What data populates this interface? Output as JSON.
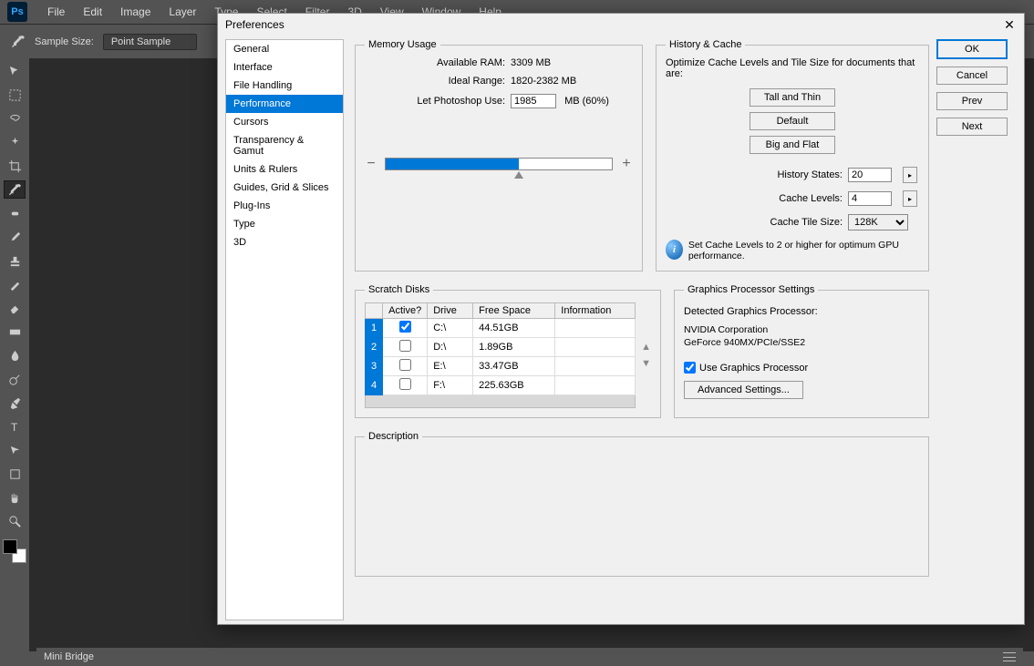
{
  "app": {
    "logo": "Ps"
  },
  "menu": [
    "File",
    "Edit",
    "Image",
    "Layer",
    "Type",
    "Select",
    "Filter",
    "3D",
    "View",
    "Window",
    "Help"
  ],
  "options": {
    "sample_label": "Sample Size:",
    "sample_value": "Point Sample"
  },
  "bottom_panel": "Mini Bridge",
  "dialog": {
    "title": "Preferences",
    "sidebar": [
      "General",
      "Interface",
      "File Handling",
      "Performance",
      "Cursors",
      "Transparency & Gamut",
      "Units & Rulers",
      "Guides, Grid & Slices",
      "Plug-Ins",
      "Type",
      "3D"
    ],
    "selected_index": 3,
    "buttons": {
      "ok": "OK",
      "cancel": "Cancel",
      "prev": "Prev",
      "next": "Next"
    },
    "memory": {
      "legend": "Memory Usage",
      "available_lbl": "Available RAM:",
      "available_val": "3309 MB",
      "ideal_lbl": "Ideal Range:",
      "ideal_val": "1820-2382 MB",
      "let_lbl": "Let Photoshop Use:",
      "let_val": "1985",
      "let_unit": "MB (60%)",
      "minus": "−",
      "plus": "+"
    },
    "history": {
      "legend": "History & Cache",
      "desc": "Optimize Cache Levels and Tile Size for documents that are:",
      "tall": "Tall and Thin",
      "default": "Default",
      "big": "Big and Flat",
      "states_lbl": "History States:",
      "states_val": "20",
      "levels_lbl": "Cache Levels:",
      "levels_val": "4",
      "tile_lbl": "Cache Tile Size:",
      "tile_val": "128K",
      "info": "Set Cache Levels to 2 or higher for optimum GPU performance."
    },
    "scratch": {
      "legend": "Scratch Disks",
      "headers": {
        "active": "Active?",
        "drive": "Drive",
        "free": "Free Space",
        "info": "Information"
      },
      "rows": [
        {
          "n": "1",
          "active": true,
          "drive": "C:\\",
          "free": "44.51GB",
          "info": ""
        },
        {
          "n": "2",
          "active": false,
          "drive": "D:\\",
          "free": "1.89GB",
          "info": ""
        },
        {
          "n": "3",
          "active": false,
          "drive": "E:\\",
          "free": "33.47GB",
          "info": ""
        },
        {
          "n": "4",
          "active": false,
          "drive": "F:\\",
          "free": "225.63GB",
          "info": ""
        }
      ]
    },
    "gpu": {
      "legend": "Graphics Processor Settings",
      "detected_lbl": "Detected Graphics Processor:",
      "vendor": "NVIDIA Corporation",
      "model": "GeForce 940MX/PCIe/SSE2",
      "use_lbl": "Use Graphics Processor",
      "use_checked": true,
      "adv": "Advanced Settings..."
    },
    "description": {
      "legend": "Description"
    }
  }
}
